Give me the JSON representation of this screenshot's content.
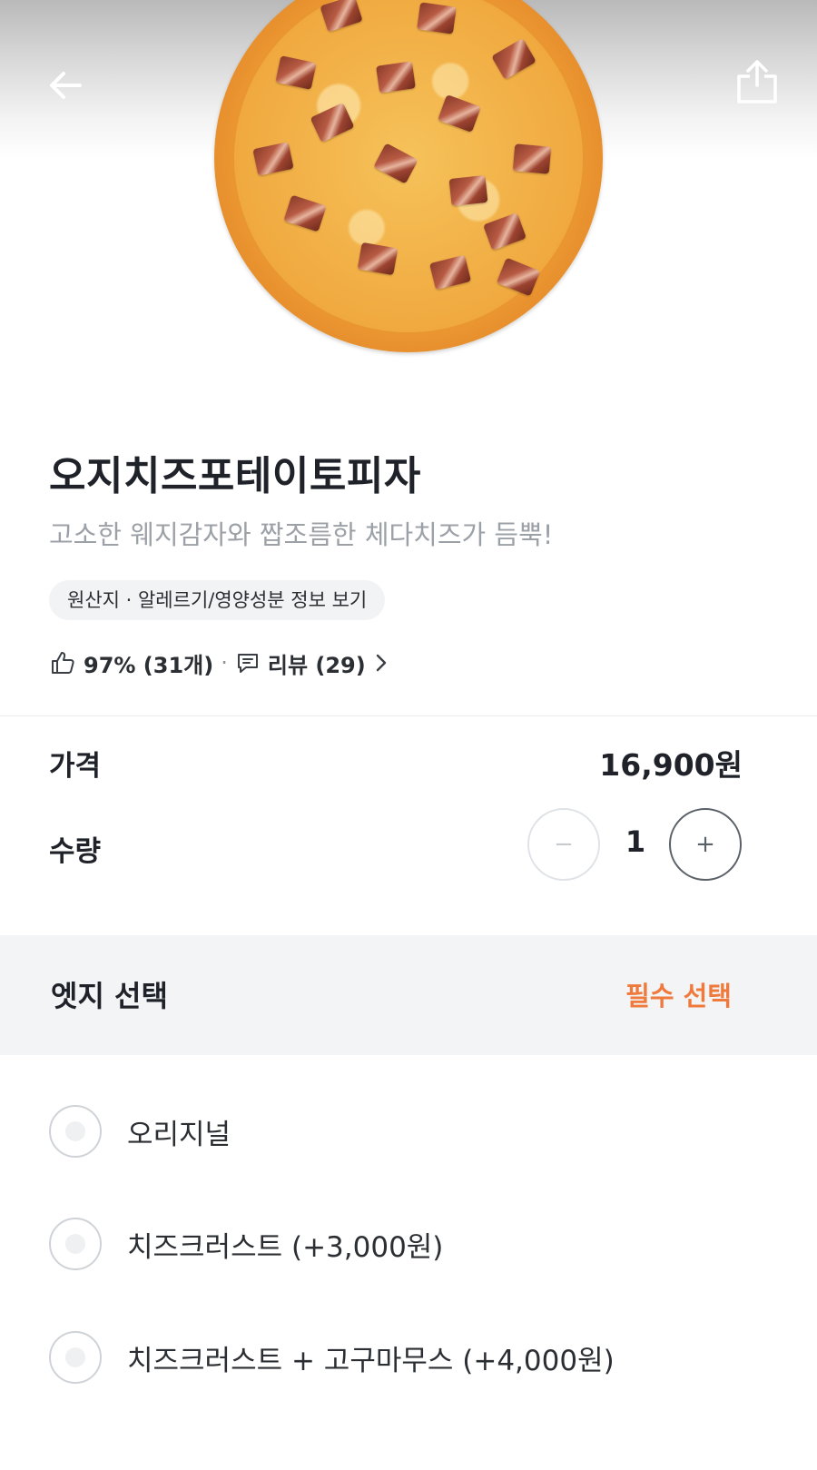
{
  "header": {
    "back_icon": "arrow-left-icon",
    "share_icon": "share-upload-icon"
  },
  "product": {
    "name": "오지치즈포테이토피자",
    "description": "고소한 웨지감자와 짭조름한 체다치즈가 듬뿍!",
    "info_link": "원산지 · 알레르기/영양성분 정보 보기",
    "rating_text": "97% (31개)",
    "review_text": "리뷰 (29)",
    "separator": "·"
  },
  "price": {
    "label": "가격",
    "value": "16,900원"
  },
  "quantity": {
    "label": "수량",
    "value": "1",
    "minus": "−",
    "plus": "+"
  },
  "option_group": {
    "title": "엣지 선택",
    "required": "필수 선택",
    "options": [
      {
        "label": "오리지널"
      },
      {
        "label": "치즈크러스트 (+3,000원)"
      },
      {
        "label": "치즈크러스트 + 고구마무스 (+4,000원)"
      }
    ]
  },
  "colors": {
    "accent": "#f07a3c",
    "text": "#1f2329",
    "muted": "#9ca1a7",
    "section_bg": "#f2f4f6"
  }
}
